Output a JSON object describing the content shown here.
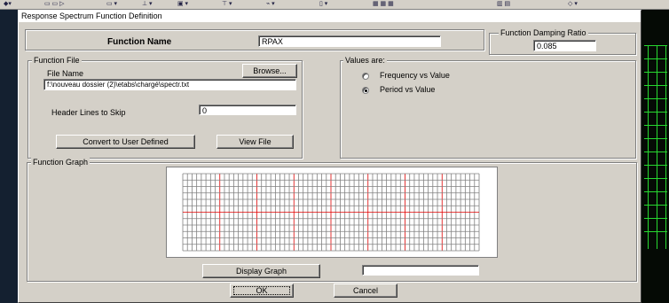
{
  "dialog": {
    "title": "Response Spectrum  Function Definition",
    "function_name_label": "Function Name",
    "function_name_value": "RPAX",
    "damping_label": "Function Damping Ratio",
    "damping_value": "0.085"
  },
  "function_file": {
    "legend": "Function File",
    "file_name_label": "File Name",
    "browse_label": "Browse...",
    "file_path": "f:\\nouveau dossier (2)\\etabs\\chargé\\spectr.txt",
    "header_lines_label": "Header Lines to Skip",
    "header_lines_value": "0",
    "convert_label": "Convert to User Defined",
    "view_file_label": "View File"
  },
  "values_are": {
    "legend": "Values are:",
    "options": [
      {
        "label": "Frequency vs Value",
        "selected": false
      },
      {
        "label": "Period vs Value",
        "selected": true
      }
    ]
  },
  "graph": {
    "legend": "Function Graph",
    "display_label": "Display Graph",
    "status_value": "",
    "grid_color": "#808080",
    "accent_color": "#e00000"
  },
  "footer": {
    "ok_label": "OK",
    "cancel_label": "Cancel"
  }
}
